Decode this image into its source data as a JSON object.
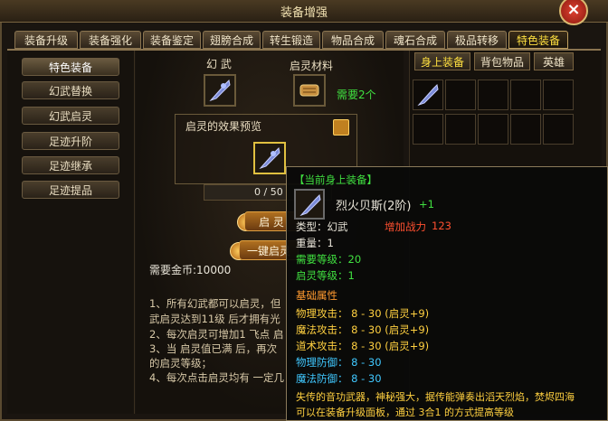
{
  "window": {
    "title": "装备增强",
    "close": "×"
  },
  "tabs": [
    "装备升级",
    "装备强化",
    "装备鉴定",
    "翅膀合成",
    "转生锻造",
    "物品合成",
    "魂石合成",
    "极品转移",
    "特色装备"
  ],
  "side_menu": [
    "特色装备",
    "幻武替换",
    "幻武启灵",
    "足迹升阶",
    "足迹继承",
    "足迹提品"
  ],
  "center": {
    "slot1_label": "幻 武",
    "slot2_label": "启灵材料",
    "need_count": "需要2个",
    "preview_label": "启灵的效果预览",
    "progress": "0 / 50",
    "btn_qiling": "启 灵",
    "btn_onekey": "一键启灵",
    "gold": "需要金币:10000",
    "notes": [
      "1、所有幻武都可以启灵，但",
      "武启灵达到11级 后才拥有光",
      "2、每次启灵可增加1 飞点 启",
      "3、当 启灵值已满 后，再次",
      "的启灵等级；",
      "4、每次点击启灵均有 一定几"
    ]
  },
  "right_tabs": [
    "身上装备",
    "背包物品",
    "英雄"
  ],
  "tooltip": {
    "header": "【当前身上装备】",
    "item_name": "烈火贝斯(2阶)",
    "item_plus": "+1",
    "type": "类型：幻武",
    "power_label": "增加战力",
    "power_value": "123",
    "weight": "重量：1",
    "req_level": "需要等级：20",
    "qiling_level": "启灵等级：1",
    "base_attr": "基础属性",
    "stats": [
      "物理攻击：  8 - 30 (启灵+9)",
      "魔法攻击：  8 - 30 (启灵+9)",
      "道术攻击：  8 - 30 (启灵+9)",
      "物理防御：  8 - 30",
      "魔法防御：  8 - 30"
    ],
    "desc_line1": "失传的音功武器，神秘强大，据传能弹奏出滔天烈焰，焚烬四海",
    "desc_line2": "可以在装备升级面板，通过 3合1 的方式提高等级"
  }
}
